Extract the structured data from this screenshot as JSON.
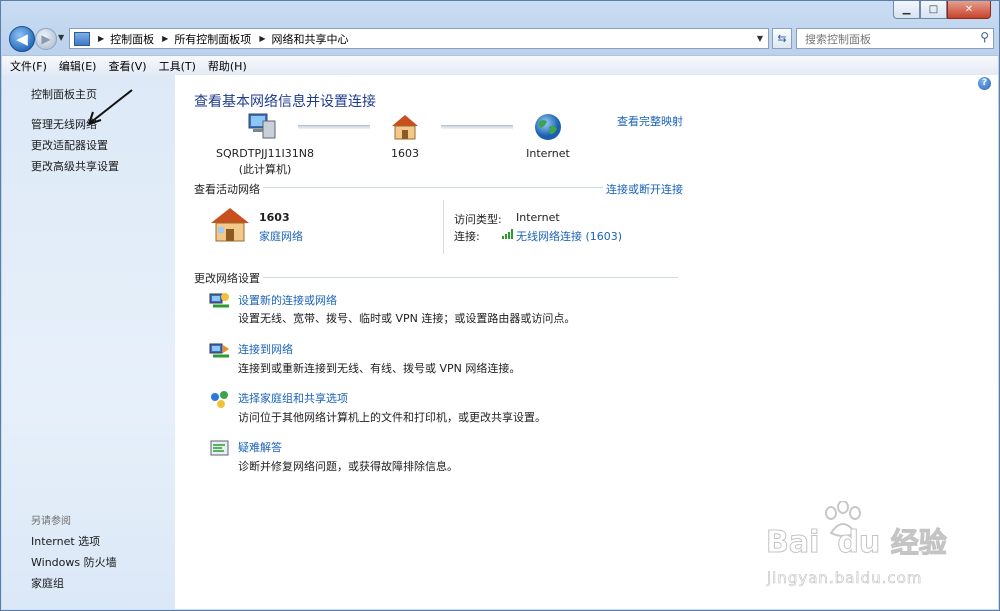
{
  "window": {
    "buttons": {
      "minimize": "▁",
      "maximize": "□",
      "close": "✕"
    }
  },
  "nav": {
    "breadcrumbs": [
      "控制面板",
      "所有控制面板项",
      "网络和共享中心"
    ],
    "search_placeholder": "搜索控制面板"
  },
  "menu": [
    "文件(F)",
    "编辑(E)",
    "查看(V)",
    "工具(T)",
    "帮助(H)"
  ],
  "sidebar": {
    "items": [
      "控制面板主页",
      "管理无线网络",
      "更改适配器设置",
      "更改高级共享设置"
    ],
    "see_also_title": "另请参阅",
    "see_also": [
      "Internet 选项",
      "Windows 防火墙",
      "家庭组"
    ]
  },
  "main": {
    "title": "查看基本网络信息并设置连接",
    "view_full_map": "查看完整映射",
    "map": {
      "computer_name": "SQRDTPJJ11I31N8",
      "computer_sub": "(此计算机)",
      "network_name": "1603",
      "internet": "Internet"
    },
    "active_section": "查看活动网络",
    "connect_disconnect": "连接或断开连接",
    "active": {
      "name": "1603",
      "type": "家庭网络",
      "access_type_label": "访问类型:",
      "access_type_value": "Internet",
      "connection_label": "连接:",
      "connection_value": "无线网络连接 (1603)"
    },
    "change_section": "更改网络设置",
    "tasks": [
      {
        "title": "设置新的连接或网络",
        "desc": "设置无线、宽带、拨号、临时或 VPN 连接；或设置路由器或访问点。",
        "icon": "new-connection-icon"
      },
      {
        "title": "连接到网络",
        "desc": "连接到或重新连接到无线、有线、拨号或 VPN 网络连接。",
        "icon": "connect-network-icon"
      },
      {
        "title": "选择家庭组和共享选项",
        "desc": "访问位于其他网络计算机上的文件和打印机，或更改共享设置。",
        "icon": "homegroup-icon"
      },
      {
        "title": "疑难解答",
        "desc": "诊断并修复网络问题，或获得故障排除信息。",
        "icon": "troubleshoot-icon"
      }
    ]
  },
  "watermark": {
    "brand": "Bai",
    "brand2": "du",
    "text": "经验",
    "url": "jingyan.baidu.com"
  }
}
